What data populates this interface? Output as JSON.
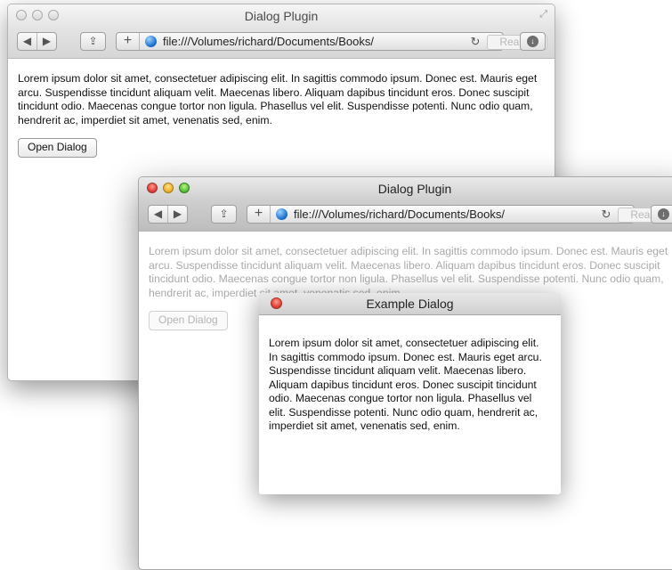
{
  "back_window": {
    "title": "Dialog Plugin",
    "url": "file:///Volumes/richard/Documents/Books/",
    "reader_label": "Reader",
    "content_text": "Lorem ipsum dolor sit amet, consectetuer adipiscing elit. In sagittis commodo ipsum. Donec est. Mauris eget arcu. Suspendisse tincidunt aliquam velit. Maecenas libero. Aliquam dapibus tincidunt eros. Donec suscipit tincidunt odio. Maecenas congue tortor non ligula. Phasellus vel elit. Suspendisse potenti. Nunc odio quam, hendrerit ac, imperdiet sit amet, venenatis sed, enim.",
    "button_label": "Open Dialog"
  },
  "front_window": {
    "title": "Dialog Plugin",
    "url": "file:///Volumes/richard/Documents/Books/",
    "reader_label": "Reader",
    "content_text": "Lorem ipsum dolor sit amet, consectetuer adipiscing elit. In sagittis commodo ipsum. Donec est. Mauris eget arcu. Suspendisse tincidunt aliquam velit. Maecenas libero. Aliquam dapibus tincidunt eros. Donec suscipit tincidunt odio. Maecenas congue tortor non ligula. Phasellus vel elit. Suspendisse potenti. Nunc odio quam, hendrerit ac, imperdiet sit amet, venenatis sed, enim.",
    "button_label": "Open Dialog"
  },
  "dialog": {
    "title": "Example Dialog",
    "content_text": "Lorem ipsum dolor sit amet, consectetuer adipiscing elit. In sagittis commodo ipsum. Donec est. Mauris eget arcu. Suspendisse tincidunt aliquam velit. Maecenas libero. Aliquam dapibus tincidunt eros. Donec suscipit tincidunt odio. Maecenas congue tortor non ligula. Phasellus vel elit. Suspendisse potenti. Nunc odio quam, hendrerit ac, imperdiet sit amet, venenatis sed, enim."
  },
  "icons": {
    "back": "◀",
    "forward": "▶",
    "share": "⇪",
    "add": "+",
    "reload": "↻",
    "download": "↓",
    "fullscreen": "⤢"
  },
  "colors": {
    "close": "#e0443a",
    "minimize": "#f0b42e",
    "zoom": "#5cc43a",
    "globe": "#1b6fd1"
  }
}
